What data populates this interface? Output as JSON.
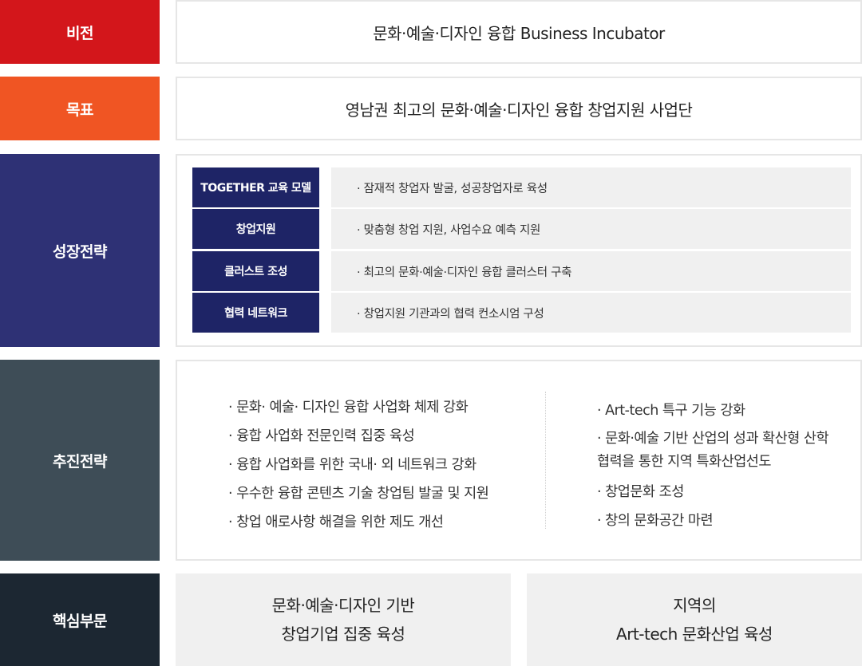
{
  "colors": {
    "vision": "#d3161b",
    "goal": "#f05523",
    "growth": "#2e3175",
    "promotion": "#3e4d57",
    "core": "#1c2732",
    "growth_item": "#1e2466"
  },
  "vision": {
    "label": "비전",
    "content": "문화·예술·디자인 융합 Business Incubator"
  },
  "goal": {
    "label": "목표",
    "content": "영남권 최고의 문화·예술·디자인 융합 창업지원 사업단"
  },
  "growth": {
    "label": "성장전략",
    "items": [
      {
        "name": "TOGETHER 교육 모델",
        "desc": "· 잠재적 창업자 발굴, 성공창업자로 육성"
      },
      {
        "name": "창업지원",
        "desc": "· 맞춤형 창업 지원, 사업수요 예측 지원"
      },
      {
        "name": "클러스트 조성",
        "desc": "· 최고의 문화·예술·디자인 융합 클러스터 구축"
      },
      {
        "name": "협력 네트워크",
        "desc": "· 창업지원 기관과의 협력 컨소시엄 구성"
      }
    ]
  },
  "promotion": {
    "label": "추진전략",
    "left": [
      "· 문화· 예술· 디자인 융합 사업화 체제 강화",
      "· 융합 사업화 전문인력 집중 육성",
      "· 융합 사업화를 위한 국내· 외 네트워크 강화",
      "· 우수한 융합 콘텐츠 기술 창업팀 발굴 및 지원",
      "· 창업 애로사항 해결을 위한 제도 개선"
    ],
    "right": [
      "· Art-tech 특구 기능 강화",
      "· 문화·예술 기반 산업의 성과 확산형 산학협력을 통한 지역 특화산업선도",
      "· 창업문화 조성",
      "· 창의 문화공간 마련"
    ]
  },
  "core": {
    "label": "핵심부문",
    "sections": [
      {
        "line1": "문화·예술·디자인 기반",
        "line2": "창업기업 집중 육성"
      },
      {
        "line1": "지역의",
        "line2": "Art-tech 문화산업 육성"
      }
    ]
  }
}
